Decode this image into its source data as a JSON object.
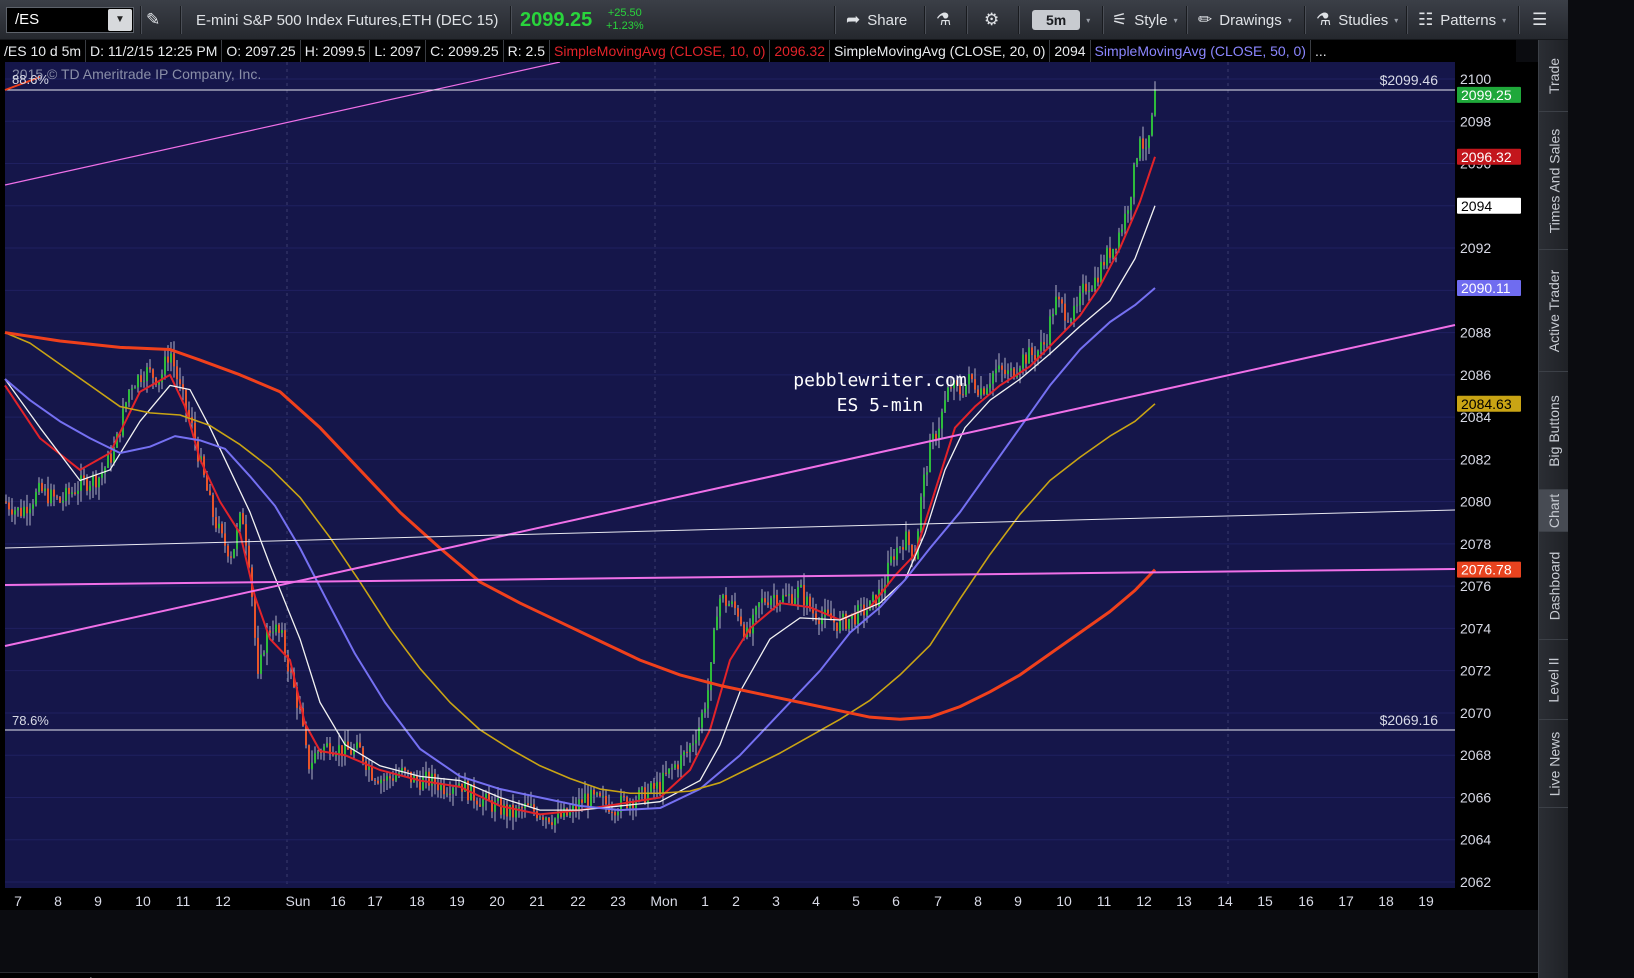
{
  "toolbar": {
    "symbol": "/ES",
    "instrument": "E-mini S&P 500 Index Futures,ETH (DEC 15)",
    "last_price": "2099.25",
    "change": "+25.50",
    "change_pct": "+1.23%",
    "share_label": "Share",
    "timeframe": "5m",
    "style_label": "Style",
    "drawings_label": "Drawings",
    "studies_label": "Studies",
    "patterns_label": "Patterns"
  },
  "infobar": {
    "period": "/ES 10 d 5m",
    "date": "D: 11/2/15 12:25 PM",
    "open": "O: 2097.25",
    "high": "H: 2099.5",
    "low": "L: 2097",
    "close": "C: 2099.25",
    "range": "R: 2.5",
    "sma10_label": "SimpleMovingAvg (CLOSE, 10, 0)",
    "sma10_value": "2096.32",
    "sma20_label": "SimpleMovingAvg (CLOSE, 20, 0)",
    "sma20_value": "2094",
    "sma50_label": "SimpleMovingAvg (CLOSE, 50, 0)",
    "more": "..."
  },
  "chart": {
    "copyright": "2015 © TD Ameritrade IP Company, Inc.",
    "watermark_line1": "pebblewriter.com",
    "watermark_line2": "ES 5-min",
    "fib_top_label": "88.6%",
    "fib_top_price": "$2099.46",
    "fib_bottom_label": "78.6%",
    "fib_bottom_price": "$2069.16",
    "y_ticks": [
      "2100",
      "2098",
      "2096",
      "2094",
      "2092",
      "2090",
      "2088",
      "2086",
      "2084",
      "2082",
      "2080",
      "2078",
      "2076",
      "2074",
      "2072",
      "2070",
      "2068",
      "2066",
      "2064",
      "2062"
    ],
    "x_ticks": [
      "7",
      "8",
      "9",
      "10",
      "11",
      "12",
      "Sun",
      "16",
      "17",
      "18",
      "19",
      "20",
      "21",
      "22",
      "23",
      "Mon",
      "1",
      "2",
      "3",
      "4",
      "5",
      "6",
      "7",
      "8",
      "9",
      "10",
      "11",
      "12",
      "13",
      "14",
      "15",
      "16",
      "17",
      "18",
      "19"
    ],
    "price_badges": [
      {
        "text": "2099.25",
        "bg": "#1fa83a",
        "fg": "#ffffff",
        "value": 2099.25
      },
      {
        "text": "2096.32",
        "bg": "#c3161c",
        "fg": "#ffffff",
        "value": 2096.32
      },
      {
        "text": "2094",
        "bg": "#ffffff",
        "fg": "#000000",
        "value": 2094
      },
      {
        "text": "2090.11",
        "bg": "#6f6cf0",
        "fg": "#ffffff",
        "value": 2090.11
      },
      {
        "text": "2084.63",
        "bg": "#c9a414",
        "fg": "#000000",
        "value": 2084.63
      },
      {
        "text": "2076.78",
        "bg": "#e8431f",
        "fg": "#ffffff",
        "value": 2076.78
      }
    ],
    "colors": {
      "background": "#15164a",
      "sma10": "#e2232a",
      "sma20": "#f2f2f2",
      "sma50": "#7570f2",
      "sma100": "#c9a414",
      "sma200": "#f0401c",
      "trendline": "#f070e8",
      "candle_up": "#2dbb3c",
      "candle_down": "#e8542a"
    }
  },
  "sidebar": {
    "tabs": [
      "Trade",
      "Times And Sales",
      "Active Trader",
      "Big Buttons",
      "Chart",
      "Dashboard",
      "Level II",
      "Live News"
    ]
  }
}
